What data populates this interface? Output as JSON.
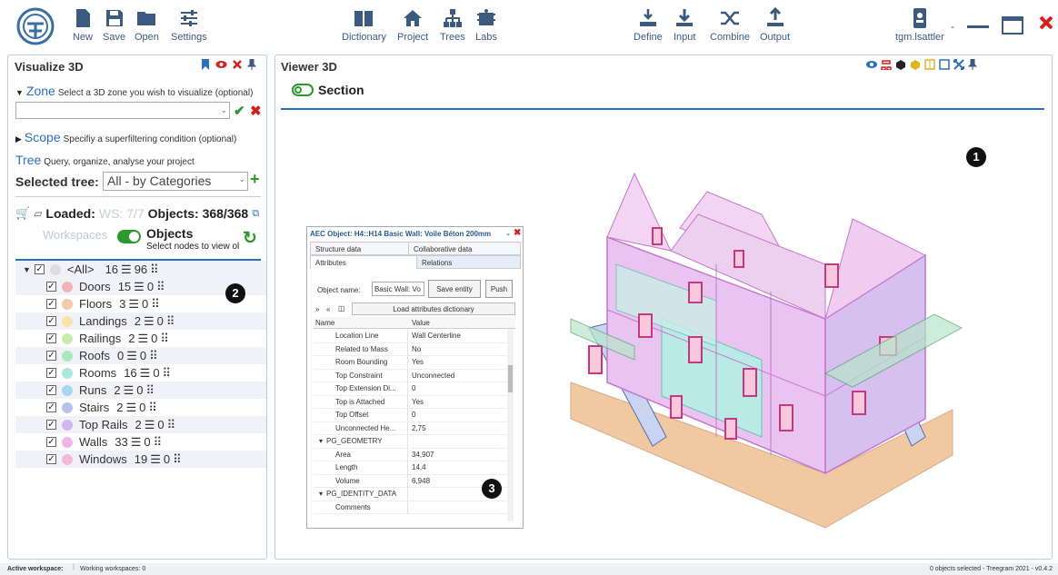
{
  "toolbar": {
    "new": "New",
    "save": "Save",
    "open": "Open",
    "settings": "Settings",
    "dictionary": "Dictionary",
    "project": "Project",
    "trees": "Trees",
    "labs": "Labs",
    "define": "Define",
    "input": "Input",
    "combine": "Combine",
    "output": "Output",
    "user": "tgm.lsattler",
    "user_caret": "-"
  },
  "left_panel": {
    "title": "Visualize 3D",
    "zone_label": "Zone",
    "zone_hint": "Select a 3D zone you wish to visualize (optional)",
    "zone_value": "",
    "scope_label": "Scope",
    "scope_hint": "Specifiy a superfiltering condition (optional)",
    "tree_label": "Tree",
    "tree_hint": "Query, organize, analyse your project",
    "selected_tree_label": "Selected tree:",
    "selected_tree_value": "All - by Categories",
    "loaded_label": "Loaded:",
    "ws_text": "WS: 7/7",
    "objects_count": "Objects: 368/368",
    "workspaces_label": "Workspaces",
    "objects_label": "Objects",
    "objects_hint": "Select nodes to view ol",
    "root": {
      "label": "<All>",
      "count": "16",
      "mid": "96"
    },
    "items": [
      {
        "label": "Doors",
        "count": "15",
        "mid": "0",
        "color": "#f4b3bb"
      },
      {
        "label": "Floors",
        "count": "3",
        "mid": "0",
        "color": "#f6c9ad"
      },
      {
        "label": "Landings",
        "count": "2",
        "mid": "0",
        "color": "#f6e4a8"
      },
      {
        "label": "Railings",
        "count": "2",
        "mid": "0",
        "color": "#c9ecae"
      },
      {
        "label": "Roofs",
        "count": "0",
        "mid": "0",
        "color": "#a9e8bd"
      },
      {
        "label": "Rooms",
        "count": "16",
        "mid": "0",
        "color": "#a9eadc"
      },
      {
        "label": "Runs",
        "count": "2",
        "mid": "0",
        "color": "#a9d8ee"
      },
      {
        "label": "Stairs",
        "count": "2",
        "mid": "0",
        "color": "#b6c4f0"
      },
      {
        "label": "Top Rails",
        "count": "2",
        "mid": "0",
        "color": "#cfb8f0"
      },
      {
        "label": "Walls",
        "count": "33",
        "mid": "0",
        "color": "#f0b4e6"
      },
      {
        "label": "Windows",
        "count": "19",
        "mid": "0",
        "color": "#f4b9d8"
      }
    ]
  },
  "viewer": {
    "title": "Viewer 3D",
    "section_label": "Section"
  },
  "popup": {
    "title": "AEC Object: H4::H14 Basic Wall: Voile Béton 200mm",
    "tabs": [
      "Structure data",
      "Collaborative data",
      "Attributes",
      "Relations"
    ],
    "object_name_label": "Object name:",
    "object_name_value": "Basic Wall: Vo",
    "save_entity": "Save entity",
    "push": "Push",
    "load_dict": "Load attributes dictionary",
    "col_name": "Name",
    "col_value": "Value",
    "rows": [
      {
        "name": "Location Line",
        "value": "Wall Centerline"
      },
      {
        "name": "Related to Mass",
        "value": "No"
      },
      {
        "name": "Room Bounding",
        "value": "Yes"
      },
      {
        "name": "Top Constraint",
        "value": "Unconnected"
      },
      {
        "name": "Top Extension Di...",
        "value": "0"
      },
      {
        "name": "Top is Attached",
        "value": "Yes"
      },
      {
        "name": "Top Offset",
        "value": "0"
      },
      {
        "name": "Unconnected He...",
        "value": "2,75"
      },
      {
        "name": "PG_GEOMETRY",
        "value": ""
      },
      {
        "name": "Area",
        "value": "34,907"
      },
      {
        "name": "Length",
        "value": "14,4"
      },
      {
        "name": "Volume",
        "value": "6,948"
      },
      {
        "name": "PG_IDENTITY_DATA",
        "value": ""
      },
      {
        "name": "Comments",
        "value": ""
      }
    ]
  },
  "markers": [
    "1",
    "2",
    "3"
  ],
  "status": {
    "active": "Active workspace:",
    "working": "Working workspaces: 0",
    "right": "0 objects selected  -  Treegram 2021 - v0.4.2"
  }
}
